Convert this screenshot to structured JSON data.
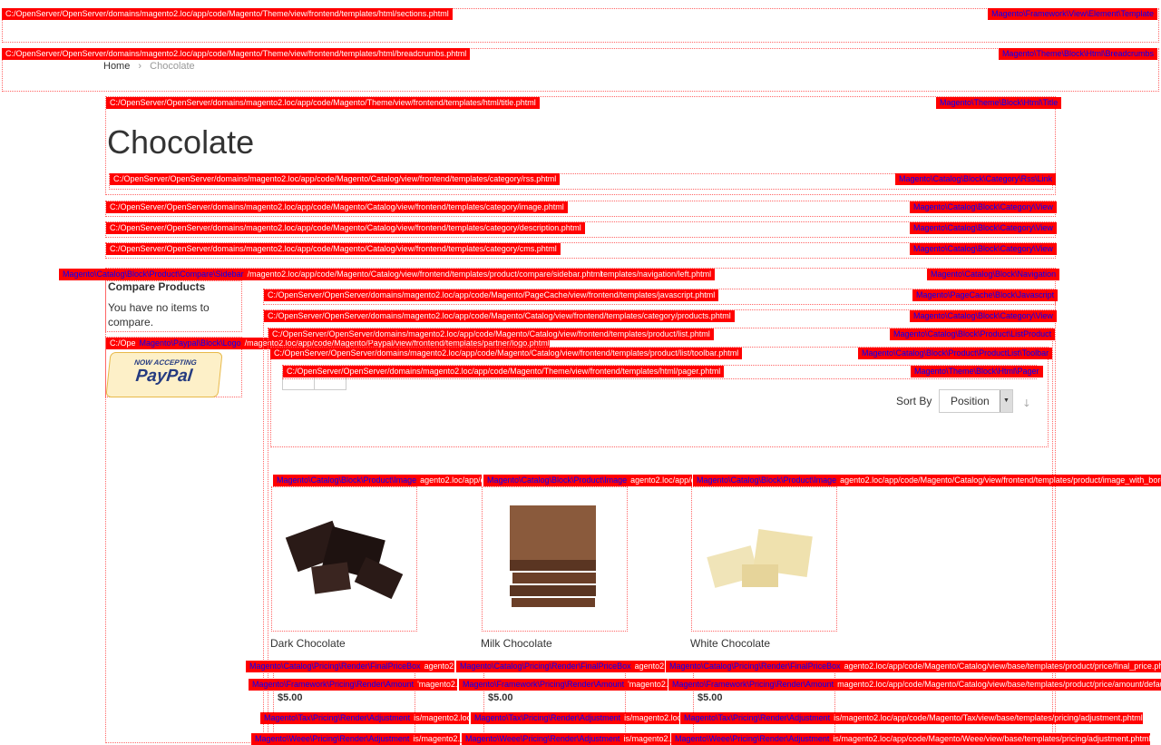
{
  "breadcrumbs": {
    "home": "Home",
    "separator": "›",
    "current": "Chocolate"
  },
  "page_title": "Chocolate",
  "sidebar": {
    "compare_title": "Compare Products",
    "compare_empty": "You have no items to compare.",
    "paypal_top": "NOW ACCEPTING",
    "paypal_logo": "PayPal"
  },
  "toolbar": {
    "sort_by_label": "Sort By",
    "sort_value": "Position"
  },
  "products": [
    {
      "name": "Dark Chocolate",
      "price": "$5.00"
    },
    {
      "name": "Milk Chocolate",
      "price": "$5.00"
    },
    {
      "name": "White Chocolate",
      "price": "$5.00"
    }
  ],
  "hints": {
    "sections": {
      "path": "C:/OpenServer/OpenServer/domains/magento2.loc/app/code/Magento/Theme/view/frontend/templates/html/sections.phtml",
      "cls": "Magento\\Framework\\View\\Element\\Template"
    },
    "breadcrumbs": {
      "path": "C:/OpenServer/OpenServer/domains/magento2.loc/app/code/Magento/Theme/view/frontend/templates/html/breadcrumbs.phtml",
      "cls": "Magento\\Theme\\Block\\Html\\Breadcrumbs"
    },
    "title": {
      "path": "C:/OpenServer/OpenServer/domains/magento2.loc/app/code/Magento/Theme/view/frontend/templates/html/title.phtml",
      "cls": "Magento\\Theme\\Block\\Html\\Title"
    },
    "rss": {
      "path": "C:/OpenServer/OpenServer/domains/magento2.loc/app/code/Magento/Catalog/view/frontend/templates/category/rss.phtml",
      "cls": "Magento\\Catalog\\Block\\Category\\Rss\\Link"
    },
    "image": {
      "path": "C:/OpenServer/OpenServer/domains/magento2.loc/app/code/Magento/Catalog/view/frontend/templates/category/image.phtml",
      "cls": "Magento\\Catalog\\Block\\Category\\View"
    },
    "description": {
      "path": "C:/OpenServer/OpenServer/domains/magento2.loc/app/code/Magento/Catalog/view/frontend/templates/category/description.phtml",
      "cls": "Magento\\Catalog\\Block\\Category\\View"
    },
    "cms": {
      "path": "C:/OpenServer/OpenServer/domains/magento2.loc/app/code/Magento/Catalog/view/frontend/templates/category/cms.phtml",
      "cls": "Magento\\Catalog\\Block\\Category\\View"
    },
    "compare": {
      "cls": "Magento\\Catalog\\Block\\Product\\Compare\\Sidebar",
      "path": "/magento2.loc/app/code/Magento/Catalog/view/frontend/templates/product/compare/sidebar.phtml"
    },
    "navigation": {
      "path": "d/templates/navigation/left.phtml",
      "cls": "Magento\\Catalog\\Block\\Navigation"
    },
    "paypal": {
      "prefix": "C:/Ope",
      "cls": "Magento\\Paypal\\Block\\Logo",
      "path": "/magento2.loc/app/code/Magento/Paypal/view/frontend/templates/partner/logo.phtml"
    },
    "javascript": {
      "path": "C:/OpenServer/OpenServer/domains/magento2.loc/app/code/Magento/PageCache/view/frontend/templates/javascript.phtml",
      "cls": "Magento\\PageCache\\Block\\Javascript"
    },
    "products": {
      "path": "C:/OpenServer/OpenServer/domains/magento2.loc/app/code/Magento/Catalog/view/frontend/templates/category/products.phtml",
      "cls": "Magento\\Catalog\\Block\\Category\\View"
    },
    "list": {
      "path": "C:/OpenServer/OpenServer/domains/magento2.loc/app/code/Magento/Catalog/view/frontend/templates/product/list.phtml",
      "cls": "Magento\\Catalog\\Block\\Product\\ListProduct"
    },
    "toolbar": {
      "path": "C:/OpenServer/OpenServer/domains/magento2.loc/app/code/Magento/Catalog/view/frontend/templates/product/list/toolbar.phtml",
      "cls": "Magento\\Catalog\\Block\\Product\\ProductList\\Toolbar"
    },
    "pager": {
      "path": "C:/OpenServer/OpenServer/domains/magento2.loc/app/code/Magento/Theme/view/frontend/templates/html/pager.phtml",
      "cls": "Magento\\Theme\\Block\\Html\\Pager"
    },
    "product_image": {
      "cls": "Magento\\Catalog\\Block\\Product\\Image",
      "path_short": "agento2.loc/app/cu",
      "path_full": "agento2.loc/app/code/Magento/Catalog/view/frontend/templates/product/image_with_borders.phtml"
    },
    "final_price": {
      "cls": "Magento\\Catalog\\Pricing\\Render\\FinalPriceBox",
      "path_short": "agento2.lo",
      "path_full": "agento2.loc/app/code/Magento/Catalog/view/base/templates/product/price/final_price.phtml"
    },
    "amount": {
      "cls": "Magento\\Framework\\Pricing\\Render\\Amount",
      "path_short": "'magento2.lo",
      "path_full": "magento2.loc/app/code/Magento/Catalog/view/base/templates/product/price/amount/default.phtml"
    },
    "tax": {
      "cls": "Magento\\Tax\\Pricing\\Render\\Adjustment",
      "path_short": "is/magento2.loc/a",
      "path_full": "is/magento2.loc/app/code/Magento/Tax/view/base/templates/pricing/adjustment.phtml"
    },
    "weee": {
      "cls": "Magento\\Weee\\Pricing\\Render\\Adjustment",
      "path_short": "is/magento2.lo",
      "path_full": "is/magento2.loc/app/code/Magento/Weee/view/base/templates/pricing/adjustment.phtml"
    }
  }
}
